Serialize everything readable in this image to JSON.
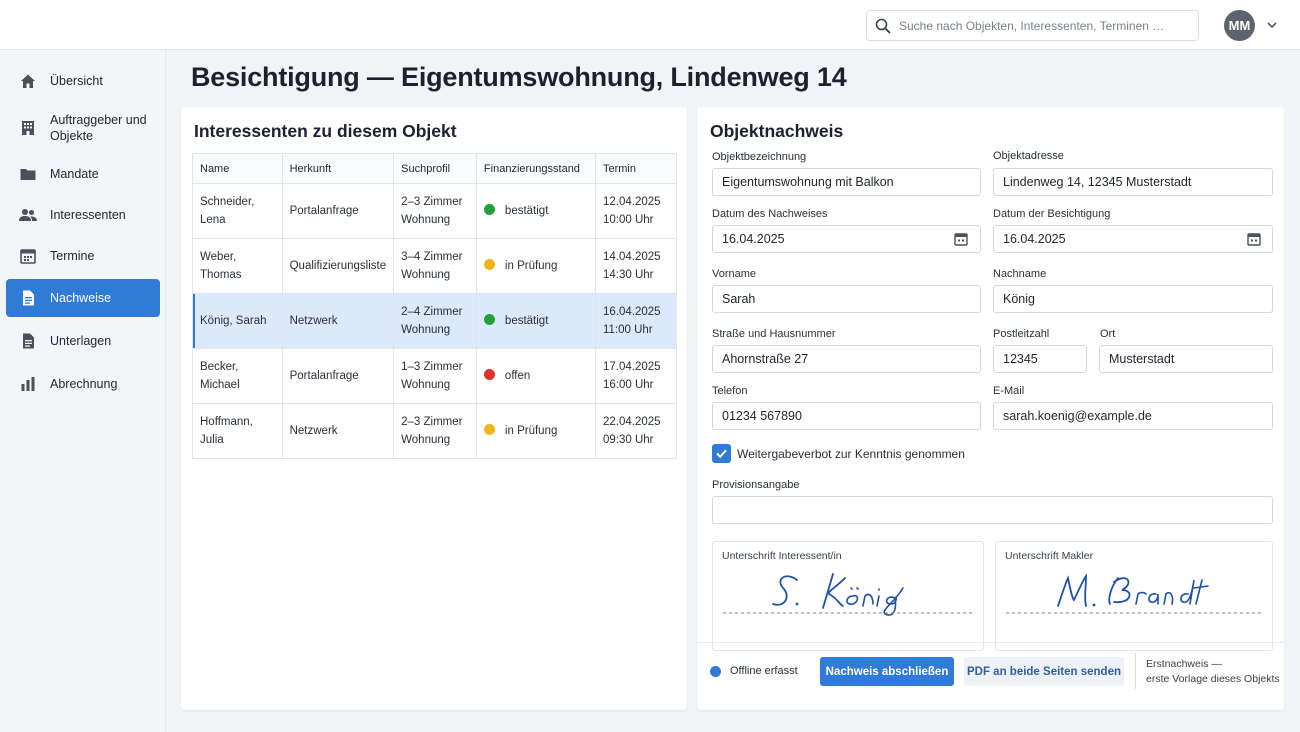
{
  "search": {
    "placeholder": "Suche nach Objekten, Interessenten, Terminen …",
    "icon": "search-icon"
  },
  "user": {
    "initials": "MM"
  },
  "sidebar": {
    "items": [
      {
        "label": "Übersicht",
        "icon": "home-icon",
        "active": false
      },
      {
        "label": "Auftraggeber und Objekte",
        "icon": "building-icon",
        "active": false
      },
      {
        "label": "Mandate",
        "icon": "folder-icon",
        "active": false
      },
      {
        "label": "Interessenten",
        "icon": "people-icon",
        "active": false
      },
      {
        "label": "Termine",
        "icon": "calendar-icon",
        "active": false
      },
      {
        "label": "Nachweise",
        "icon": "document-icon",
        "active": true
      },
      {
        "label": "Unterlagen",
        "icon": "file-icon",
        "active": false
      },
      {
        "label": "Abrechnung",
        "icon": "bar-chart-icon",
        "active": false
      }
    ]
  },
  "page": {
    "title": "Besichtigung — Eigentumswohnung, Lindenweg 14"
  },
  "prospects": {
    "title": "Interessenten zu diesem Objekt",
    "columns": [
      "Name",
      "Herkunft",
      "Suchprofil",
      "Finanzierungsstand",
      "Termin"
    ],
    "rows": [
      {
        "name": "Schneider, Lena",
        "source": "Portalanfrage",
        "profile_1": "2–3 Zimmer",
        "profile_2": "Wohnung",
        "status": "bestätigt",
        "status_color": "#22a03c",
        "date": "12.04.2025",
        "time": "10:00 Uhr",
        "selected": false
      },
      {
        "name": "Weber, Thomas",
        "source": "Qualifizierungsliste",
        "profile_1": "3–4 Zimmer",
        "profile_2": "Wohnung",
        "status": "in Prüfung",
        "status_color": "#f2b41c",
        "date": "14.04.2025",
        "time": "14:30 Uhr",
        "selected": false
      },
      {
        "name": "König, Sarah",
        "source": "Netzwerk",
        "profile_1": "2–4 Zimmer",
        "profile_2": "Wohnung",
        "status": "bestätigt",
        "status_color": "#22a03c",
        "date": "16.04.2025",
        "time": "11:00 Uhr",
        "selected": true
      },
      {
        "name": "Becker, Michael",
        "source": "Portalanfrage",
        "profile_1": "1–3 Zimmer",
        "profile_2": "Wohnung",
        "status": "offen",
        "status_color": "#e0322d",
        "date": "17.04.2025",
        "time": "16:00 Uhr",
        "selected": false
      },
      {
        "name": "Hoffmann, Julia",
        "source": "Netzwerk",
        "profile_1": "2–3 Zimmer",
        "profile_2": "Wohnung",
        "status": "in Prüfung",
        "status_color": "#f2b41c",
        "date": "22.04.2025",
        "time": "09:30 Uhr",
        "selected": false
      }
    ]
  },
  "form": {
    "title": "Objektnachweis",
    "object_name": {
      "label": "Objektbezeichnung",
      "value": "Eigentumswohnung mit Balkon"
    },
    "object_address": {
      "label": "Objektadresse",
      "value": "Lindenweg 14, 12345 Musterstadt"
    },
    "proof_date": {
      "label": "Datum des Nachweises",
      "value": "16.04.2025"
    },
    "viewing_date": {
      "label": "Datum der Besichtigung",
      "value": "16.04.2025"
    },
    "first_name": {
      "label": "Vorname",
      "value": "Sarah"
    },
    "last_name": {
      "label": "Nachname",
      "value": "König"
    },
    "street": {
      "label": "Straße und Hausnummer",
      "value": "Ahornstraße 27"
    },
    "zip": {
      "label": "Postleitzahl",
      "value": "12345"
    },
    "city": {
      "label": "Ort",
      "value": "Musterstadt"
    },
    "phone": {
      "label": "Telefon",
      "value": "01234 567890"
    },
    "email": {
      "label": "E-Mail",
      "value": "sarah.koenig@example.de"
    },
    "disclosure": {
      "label": "Weitergabeverbot zur Kenntnis genommen",
      "checked": true
    },
    "commission": {
      "label": "Provisionsangabe",
      "value": ""
    },
    "signature_prospect": {
      "label": "Unterschrift Interessent/in",
      "text": "S. König"
    },
    "signature_agent": {
      "label": "Unterschrift Makler",
      "text": "M. Brandt"
    }
  },
  "footer": {
    "offline_label": "Offline erfasst",
    "submit_label": "Nachweis abschließen",
    "send_label": "PDF an beide Seiten senden",
    "note_line1": "Erstnachweis —",
    "note_line2": "erste Vorlage dieses Objekts"
  },
  "colors": {
    "accent": "#2f7bd6",
    "confirmed": "#22a03c",
    "pending": "#f2b41c",
    "open": "#e0322d"
  }
}
